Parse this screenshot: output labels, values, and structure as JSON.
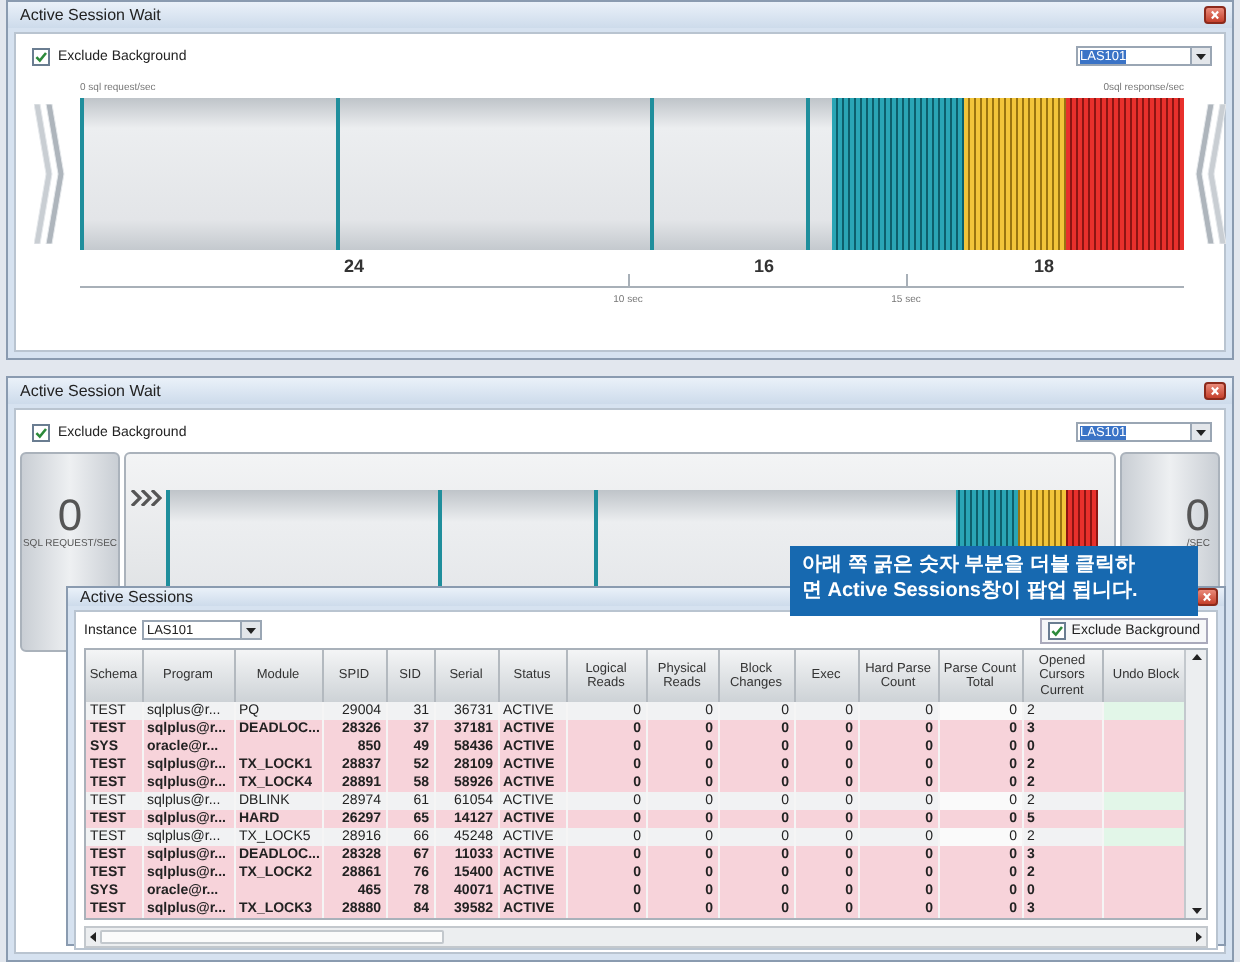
{
  "top_window": {
    "title": "Active Session Wait",
    "exclude_background": {
      "label": "Exclude Background",
      "checked": true
    },
    "instance": "LAS101",
    "request_rate": "0 sql request/sec",
    "response_rate": "0sql response/sec",
    "segment_counts": [
      "24",
      "16",
      "18"
    ],
    "time_marks": [
      "10 sec",
      "15 sec"
    ]
  },
  "bottom_window": {
    "title": "Active Session Wait",
    "exclude_background": {
      "label": "Exclude Background",
      "checked": true
    },
    "instance": "LAS101",
    "request_gauge": {
      "value": "0",
      "label": "SQL REQUEST/SEC"
    },
    "response_gauge": {
      "value": "0",
      "label": "/SEC"
    }
  },
  "callout": {
    "lines": [
      "아래 쪽 굵은 숫자 부분을 더블 클릭하",
      "면 Active Sessions창이 팝업 됩니다."
    ]
  },
  "active_sessions": {
    "title": "Active Sessions",
    "instance_label": "Instance",
    "instance": "LAS101",
    "exclude_background": {
      "label": "Exclude Background",
      "checked": true
    },
    "columns": [
      "Schema",
      "Program",
      "Module",
      "SPID",
      "SID",
      "Serial",
      "Status",
      "Logical Reads",
      "Physical Reads",
      "Block Changes",
      "Exec",
      "Hard Parse Count",
      "Parse Count Total",
      "Opened Cursors Current",
      "Undo Block"
    ],
    "rows": [
      {
        "highlighted": false,
        "schema": "TEST",
        "program": "sqlplus@r...",
        "module": "PQ",
        "spid": "29004",
        "sid": "31",
        "serial": "36731",
        "status": "ACTIVE",
        "logical_reads": "0",
        "physical_reads": "0",
        "block_changes": "0",
        "exec": "0",
        "hard_parse_count": "0",
        "parse_count_total": "0",
        "opened_cursors_current": "2"
      },
      {
        "highlighted": true,
        "schema": "TEST",
        "program": "sqlplus@r...",
        "module": "DEADLOC...",
        "spid": "28326",
        "sid": "37",
        "serial": "37181",
        "status": "ACTIVE",
        "logical_reads": "0",
        "physical_reads": "0",
        "block_changes": "0",
        "exec": "0",
        "hard_parse_count": "0",
        "parse_count_total": "0",
        "opened_cursors_current": "3"
      },
      {
        "highlighted": true,
        "schema": "SYS",
        "program": "oracle@r...",
        "spid": "850",
        "sid": "49",
        "serial": "58436",
        "status": "ACTIVE",
        "logical_reads": "0",
        "physical_reads": "0",
        "block_changes": "0",
        "exec": "0",
        "hard_parse_count": "0",
        "parse_count_total": "0",
        "opened_cursors_current": "0"
      },
      {
        "highlighted": true,
        "schema": "TEST",
        "program": "sqlplus@r...",
        "module": "TX_LOCK1",
        "spid": "28837",
        "sid": "52",
        "serial": "28109",
        "status": "ACTIVE",
        "logical_reads": "0",
        "physical_reads": "0",
        "block_changes": "0",
        "exec": "0",
        "hard_parse_count": "0",
        "parse_count_total": "0",
        "opened_cursors_current": "2"
      },
      {
        "highlighted": true,
        "schema": "TEST",
        "program": "sqlplus@r...",
        "module": "TX_LOCK4",
        "spid": "28891",
        "sid": "58",
        "serial": "58926",
        "status": "ACTIVE",
        "logical_reads": "0",
        "physical_reads": "0",
        "block_changes": "0",
        "exec": "0",
        "hard_parse_count": "0",
        "parse_count_total": "0",
        "opened_cursors_current": "2"
      },
      {
        "highlighted": false,
        "schema": "TEST",
        "program": "sqlplus@r...",
        "module": "DBLINK",
        "spid": "28974",
        "sid": "61",
        "serial": "61054",
        "status": "ACTIVE",
        "logical_reads": "0",
        "physical_reads": "0",
        "block_changes": "0",
        "exec": "0",
        "hard_parse_count": "0",
        "parse_count_total": "0",
        "opened_cursors_current": "2"
      },
      {
        "highlighted": true,
        "schema": "TEST",
        "program": "sqlplus@r...",
        "module": "HARD",
        "spid": "26297",
        "sid": "65",
        "serial": "14127",
        "status": "ACTIVE",
        "logical_reads": "0",
        "physical_reads": "0",
        "block_changes": "0",
        "exec": "0",
        "hard_parse_count": "0",
        "parse_count_total": "0",
        "opened_cursors_current": "5"
      },
      {
        "highlighted": false,
        "schema": "TEST",
        "program": "sqlplus@r...",
        "module": "TX_LOCK5",
        "spid": "28916",
        "sid": "66",
        "serial": "45248",
        "status": "ACTIVE",
        "logical_reads": "0",
        "physical_reads": "0",
        "block_changes": "0",
        "exec": "0",
        "hard_parse_count": "0",
        "parse_count_total": "0",
        "opened_cursors_current": "2"
      },
      {
        "highlighted": true,
        "schema": "TEST",
        "program": "sqlplus@r...",
        "module": "DEADLOC...",
        "spid": "28328",
        "sid": "67",
        "serial": "11033",
        "status": "ACTIVE",
        "logical_reads": "0",
        "physical_reads": "0",
        "block_changes": "0",
        "exec": "0",
        "hard_parse_count": "0",
        "parse_count_total": "0",
        "opened_cursors_current": "3"
      },
      {
        "highlighted": true,
        "schema": "TEST",
        "program": "sqlplus@r...",
        "module": "TX_LOCK2",
        "spid": "28861",
        "sid": "76",
        "serial": "15400",
        "status": "ACTIVE",
        "logical_reads": "0",
        "physical_reads": "0",
        "block_changes": "0",
        "exec": "0",
        "hard_parse_count": "0",
        "parse_count_total": "0",
        "opened_cursors_current": "2"
      },
      {
        "highlighted": true,
        "schema": "SYS",
        "program": "oracle@r...",
        "spid": "465",
        "sid": "78",
        "serial": "40071",
        "status": "ACTIVE",
        "logical_reads": "0",
        "physical_reads": "0",
        "block_changes": "0",
        "exec": "0",
        "hard_parse_count": "0",
        "parse_count_total": "0",
        "opened_cursors_current": "0"
      },
      {
        "highlighted": true,
        "schema": "TEST",
        "program": "sqlplus@r...",
        "module": "TX_LOCK3",
        "spid": "28880",
        "sid": "84",
        "serial": "39582",
        "status": "ACTIVE",
        "logical_reads": "0",
        "physical_reads": "0",
        "block_changes": "0",
        "exec": "0",
        "hard_parse_count": "0",
        "parse_count_total": "0",
        "opened_cursors_current": "3"
      }
    ]
  }
}
